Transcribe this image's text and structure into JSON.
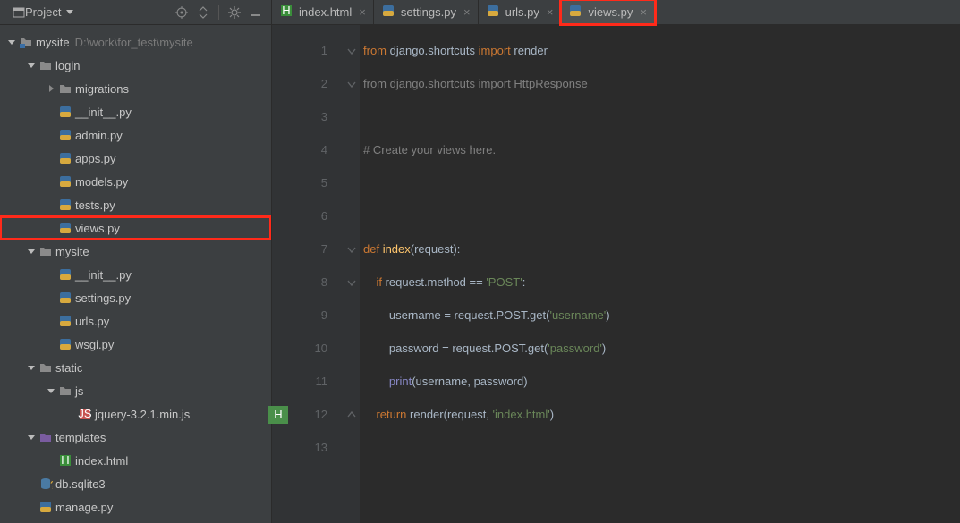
{
  "toolbar": {
    "project_label": "Project"
  },
  "tabs": [
    {
      "name": "index.html",
      "kind": "html",
      "active": false,
      "highlight": false
    },
    {
      "name": "settings.py",
      "kind": "py",
      "active": false,
      "highlight": false
    },
    {
      "name": "urls.py",
      "kind": "py",
      "active": false,
      "highlight": false
    },
    {
      "name": "views.py",
      "kind": "py",
      "active": true,
      "highlight": true
    }
  ],
  "tree": [
    {
      "d": 0,
      "arrow": "down",
      "icon": "folder-root",
      "name": "mysite",
      "path": "D:\\work\\for_test\\mysite"
    },
    {
      "d": 1,
      "arrow": "down",
      "icon": "folder",
      "name": "login"
    },
    {
      "d": 2,
      "arrow": "right",
      "icon": "folder",
      "name": "migrations"
    },
    {
      "d": 2,
      "arrow": "",
      "icon": "py",
      "name": "__init__.py"
    },
    {
      "d": 2,
      "arrow": "",
      "icon": "py",
      "name": "admin.py"
    },
    {
      "d": 2,
      "arrow": "",
      "icon": "py",
      "name": "apps.py"
    },
    {
      "d": 2,
      "arrow": "",
      "icon": "py",
      "name": "models.py"
    },
    {
      "d": 2,
      "arrow": "",
      "icon": "py",
      "name": "tests.py"
    },
    {
      "d": 2,
      "arrow": "",
      "icon": "py",
      "name": "views.py",
      "highlight": true
    },
    {
      "d": 1,
      "arrow": "down",
      "icon": "folder",
      "name": "mysite"
    },
    {
      "d": 2,
      "arrow": "",
      "icon": "py",
      "name": "__init__.py"
    },
    {
      "d": 2,
      "arrow": "",
      "icon": "py",
      "name": "settings.py"
    },
    {
      "d": 2,
      "arrow": "",
      "icon": "py",
      "name": "urls.py"
    },
    {
      "d": 2,
      "arrow": "",
      "icon": "py",
      "name": "wsgi.py"
    },
    {
      "d": 1,
      "arrow": "down",
      "icon": "folder",
      "name": "static"
    },
    {
      "d": 2,
      "arrow": "down",
      "icon": "folder",
      "name": "js"
    },
    {
      "d": 3,
      "arrow": "",
      "icon": "js",
      "name": "jquery-3.2.1.min.js"
    },
    {
      "d": 1,
      "arrow": "down",
      "icon": "folder-purple",
      "name": "templates"
    },
    {
      "d": 2,
      "arrow": "",
      "icon": "html",
      "name": "index.html"
    },
    {
      "d": 1,
      "arrow": "",
      "icon": "db",
      "name": "db.sqlite3"
    },
    {
      "d": 1,
      "arrow": "",
      "icon": "py",
      "name": "manage.py"
    }
  ],
  "code": {
    "lines": [
      [
        {
          "c": "kw",
          "t": "from "
        },
        {
          "c": "pl",
          "t": "django.shortcuts "
        },
        {
          "c": "kw",
          "t": "import "
        },
        {
          "c": "pl",
          "t": "render"
        }
      ],
      [
        {
          "c": "au",
          "t": "from django.shortcuts import HttpResponse"
        }
      ],
      [],
      [
        {
          "c": "cm",
          "t": "# Create your views here."
        }
      ],
      [],
      [],
      [
        {
          "c": "kw",
          "t": "def "
        },
        {
          "c": "fn",
          "t": "index"
        },
        {
          "c": "pl",
          "t": "(request):"
        }
      ],
      [
        {
          "c": "pl",
          "t": "    "
        },
        {
          "c": "kw",
          "t": "if "
        },
        {
          "c": "pl",
          "t": "request.method == "
        },
        {
          "c": "str",
          "t": "'POST'"
        },
        {
          "c": "pl",
          "t": ":"
        }
      ],
      [
        {
          "c": "pl",
          "t": "        username = request.POST.get("
        },
        {
          "c": "str",
          "t": "'username'"
        },
        {
          "c": "pl",
          "t": ")"
        }
      ],
      [
        {
          "c": "pl",
          "t": "        password = request.POST.get("
        },
        {
          "c": "str",
          "t": "'password'"
        },
        {
          "c": "pl",
          "t": ")"
        }
      ],
      [
        {
          "c": "pl",
          "t": "        "
        },
        {
          "c": "builtin",
          "t": "print"
        },
        {
          "c": "pl",
          "t": "(username, password)"
        }
      ],
      [
        {
          "c": "pl",
          "t": "    "
        },
        {
          "c": "kw",
          "t": "return "
        },
        {
          "c": "pl",
          "t": "render(request, "
        },
        {
          "c": "str",
          "t": "'index.html'"
        },
        {
          "c": "pl",
          "t": ")"
        }
      ],
      []
    ]
  },
  "fold_markers": [
    1,
    2,
    7,
    8,
    12
  ],
  "gutter_badge_line": 12
}
